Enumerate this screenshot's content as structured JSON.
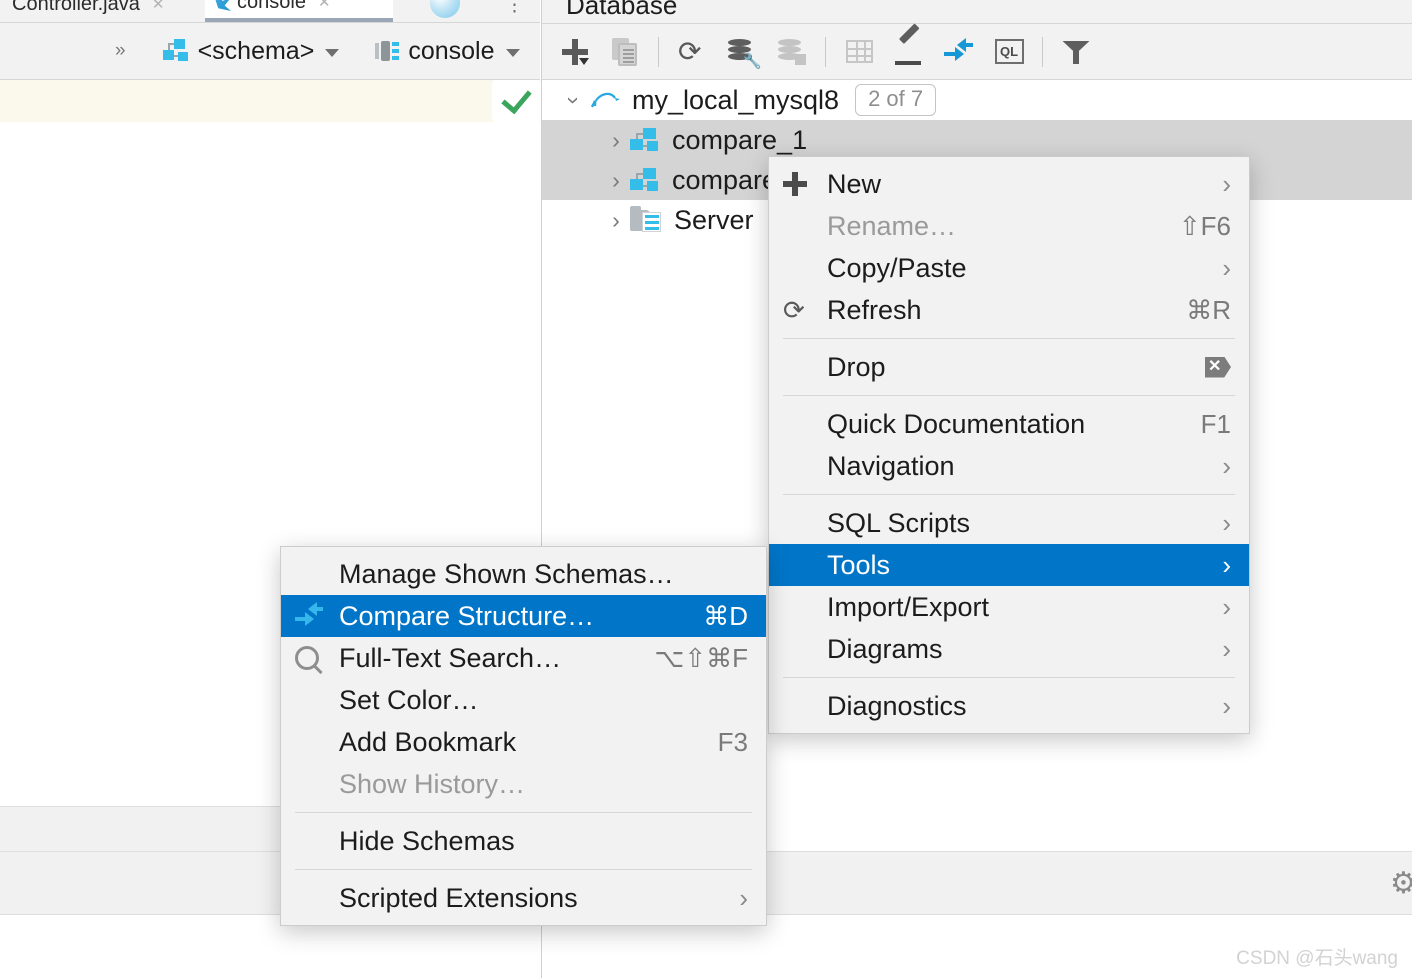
{
  "app": {
    "editor_tabs": [
      {
        "label": "Controller.java",
        "icon": "java-file-icon",
        "active": false
      },
      {
        "label": "console",
        "icon": "sql-console-icon",
        "active": true
      }
    ],
    "editor_toolbar": {
      "expand_chevrons": "»",
      "schema_selector": {
        "label": "<schema>",
        "icon": "schema-icon"
      },
      "console_selector": {
        "label": "console",
        "icon": "console-icon"
      }
    },
    "inspection_status": "check-icon"
  },
  "database_panel": {
    "title": "Database",
    "toolbar": [
      {
        "name": "new-button",
        "icon": "plus-icon"
      },
      {
        "name": "duplicate-button",
        "icon": "copy-icon"
      },
      {
        "name": "refresh-button",
        "icon": "refresh-icon"
      },
      {
        "name": "data-source-properties-button",
        "icon": "database-wrench-icon"
      },
      {
        "name": "new-data-source-button",
        "icon": "database-add-icon"
      },
      {
        "name": "open-table-button",
        "icon": "table-icon"
      },
      {
        "name": "modify-button",
        "icon": "pencil-icon"
      },
      {
        "name": "compare-button",
        "icon": "compare-arrows-icon"
      },
      {
        "name": "jump-to-query-console-button",
        "icon": "ql-icon"
      },
      {
        "name": "filter-button",
        "icon": "filter-icon"
      }
    ],
    "tree": [
      {
        "label": "my_local_mysql8",
        "icon": "mysql-icon",
        "badge": "2 of 7",
        "expanded": true,
        "selected": false,
        "indent": 0
      },
      {
        "label": "compare_1",
        "icon": "schema-icon",
        "expanded": false,
        "selected": true,
        "indent": 1
      },
      {
        "label": "compare",
        "icon": "schema-icon",
        "expanded": false,
        "selected": true,
        "indent": 1
      },
      {
        "label": "Server",
        "icon": "server-folder-icon",
        "expanded": false,
        "selected": false,
        "indent": 1
      }
    ]
  },
  "context_menu": {
    "items": [
      {
        "label": "New",
        "icon": "plus-icon",
        "shortcut": "",
        "submenu": true,
        "disabled": false,
        "highlighted": false
      },
      {
        "label": "Rename…",
        "icon": "",
        "shortcut": "⇧F6",
        "submenu": false,
        "disabled": true,
        "highlighted": false
      },
      {
        "label": "Copy/Paste",
        "icon": "",
        "shortcut": "",
        "submenu": true,
        "disabled": false,
        "highlighted": false
      },
      {
        "label": "Refresh",
        "icon": "refresh-icon",
        "shortcut": "⌘R",
        "submenu": false,
        "disabled": false,
        "highlighted": false
      },
      {
        "separator": true
      },
      {
        "label": "Drop",
        "icon": "drop-icon",
        "shortcut": "",
        "submenu": false,
        "disabled": false,
        "highlighted": false
      },
      {
        "separator": true
      },
      {
        "label": "Quick Documentation",
        "icon": "",
        "shortcut": "F1",
        "submenu": false,
        "disabled": false,
        "highlighted": false
      },
      {
        "label": "Navigation",
        "icon": "",
        "shortcut": "",
        "submenu": true,
        "disabled": false,
        "highlighted": false
      },
      {
        "separator": true
      },
      {
        "label": "SQL Scripts",
        "icon": "",
        "shortcut": "",
        "submenu": true,
        "disabled": false,
        "highlighted": false
      },
      {
        "label": "Tools",
        "icon": "",
        "shortcut": "",
        "submenu": true,
        "disabled": false,
        "highlighted": true
      },
      {
        "label": "Import/Export",
        "icon": "",
        "shortcut": "",
        "submenu": true,
        "disabled": false,
        "highlighted": false
      },
      {
        "label": "Diagrams",
        "icon": "",
        "shortcut": "",
        "submenu": true,
        "disabled": false,
        "highlighted": false
      },
      {
        "separator": true
      },
      {
        "label": "Diagnostics",
        "icon": "",
        "shortcut": "",
        "submenu": true,
        "disabled": false,
        "highlighted": false
      }
    ]
  },
  "tools_submenu": {
    "items": [
      {
        "label": "Manage Shown Schemas…",
        "icon": "",
        "shortcut": "",
        "submenu": false,
        "disabled": false,
        "highlighted": false
      },
      {
        "label": "Compare Structure…",
        "icon": "compare-arrows-icon",
        "shortcut": "⌘D",
        "submenu": false,
        "disabled": false,
        "highlighted": true
      },
      {
        "label": "Full-Text Search…",
        "icon": "search-icon",
        "shortcut": "⌥⇧⌘F",
        "submenu": false,
        "disabled": false,
        "highlighted": false
      },
      {
        "label": "Set Color…",
        "icon": "",
        "shortcut": "",
        "submenu": false,
        "disabled": false,
        "highlighted": false
      },
      {
        "label": "Add Bookmark",
        "icon": "",
        "shortcut": "F3",
        "submenu": false,
        "disabled": false,
        "highlighted": false
      },
      {
        "label": "Show History…",
        "icon": "",
        "shortcut": "",
        "submenu": false,
        "disabled": true,
        "highlighted": false
      },
      {
        "separator": true
      },
      {
        "label": "Hide Schemas",
        "icon": "",
        "shortcut": "",
        "submenu": false,
        "disabled": false,
        "highlighted": false
      },
      {
        "separator": true
      },
      {
        "label": "Scripted Extensions",
        "icon": "",
        "shortcut": "",
        "submenu": true,
        "disabled": false,
        "highlighted": false
      }
    ]
  },
  "status_bar": {
    "settings_icon": "gear-icon"
  },
  "watermark": "CSDN @石头wang",
  "colors": {
    "menu_highlight": "#0175c8",
    "tree_selection": "#d4d4d4",
    "accent_cyan": "#35bdea",
    "panel_bg": "#f2f2f2",
    "inspection_row": "#fbf8ec",
    "check_green": "#3ba55d"
  }
}
